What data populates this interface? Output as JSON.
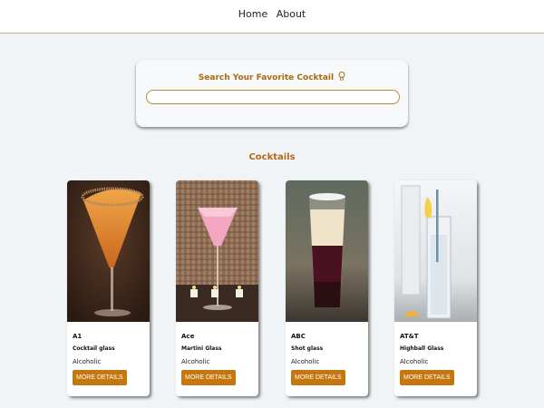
{
  "nav": {
    "home": "Home",
    "about": "About"
  },
  "search": {
    "title": "Search Your Favorite Cocktail",
    "placeholder": "",
    "value": ""
  },
  "section_title": "Cocktails",
  "cocktails": [
    {
      "name": "A1",
      "glass": "Cocktail glass",
      "type": "Alcoholic",
      "button": "MORE DETAILS"
    },
    {
      "name": "Ace",
      "glass": "Martini Glass",
      "type": "Alcoholic",
      "button": "MORE DETAILS"
    },
    {
      "name": "ABC",
      "glass": "Shot glass",
      "type": "Alcoholic",
      "button": "MORE DETAILS"
    },
    {
      "name": "AT&T",
      "glass": "Highball Glass",
      "type": "Alcoholic",
      "button": "MORE DETAILS"
    }
  ],
  "colors": {
    "accent": "#c6760f",
    "heading": "#a86a12",
    "background": "#f1f4f6"
  }
}
